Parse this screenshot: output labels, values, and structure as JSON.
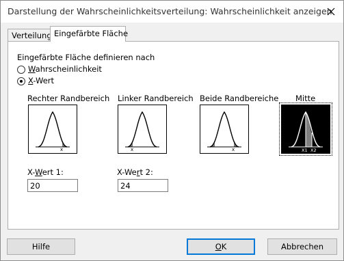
{
  "window": {
    "title": "Darstellung der Wahrscheinlichkeitsverteilung: Wahrscheinlichkeit anzeigen"
  },
  "tabs": [
    {
      "label": "Verteilung",
      "active": false
    },
    {
      "label": "Eingefärbte Fläche",
      "active": true
    }
  ],
  "define": {
    "heading": "Eingefärbte Fläche definieren nach",
    "options": [
      {
        "label_pre": "",
        "label_ul": "W",
        "label_post": "ahrscheinlichkeit",
        "checked": false
      },
      {
        "label_pre": "",
        "label_ul": "X",
        "label_post": "-Wert",
        "checked": true
      }
    ]
  },
  "regions": [
    {
      "label": "Rechter Randbereich",
      "marker": "x",
      "selected": false
    },
    {
      "label": "Linker Randbereich",
      "marker": "x",
      "selected": false
    },
    {
      "label": "Beide Randbereiche",
      "marker": "x",
      "selected": false
    },
    {
      "label": "Mitte",
      "marker_left": "X1",
      "marker_right": "X2",
      "selected": true
    }
  ],
  "xvalues": [
    {
      "label_pre": "X-",
      "label_ul": "W",
      "label_post": "ert 1:",
      "value": "20"
    },
    {
      "label_pre": "X-We",
      "label_ul": "r",
      "label_post": "t 2:",
      "value": "24"
    }
  ],
  "buttons": {
    "help": "Hilfe",
    "ok_ul": "O",
    "ok_post": "K",
    "cancel": "Abbrechen"
  },
  "colors": {
    "accent": "#0078d7",
    "shade_gray": "#808080"
  }
}
